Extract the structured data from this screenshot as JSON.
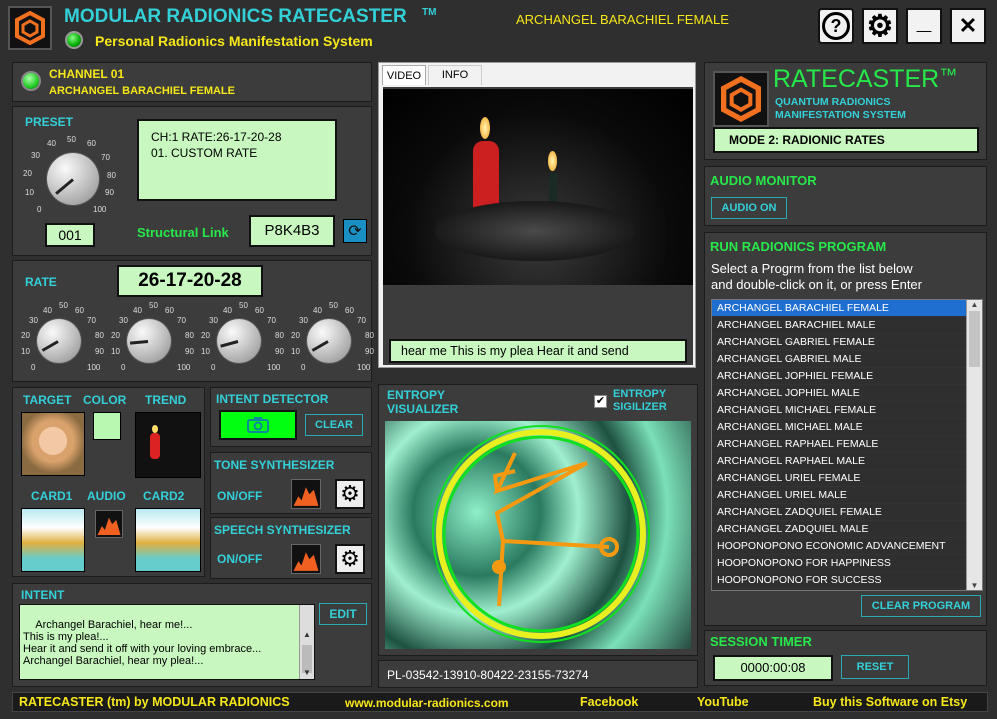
{
  "app": {
    "title": "MODULAR RADIONICS RATECASTER",
    "tm": "TM",
    "subtitle": "Personal Radionics Manifestation System",
    "current_program": "ARCHANGEL BARACHIEL FEMALE"
  },
  "window_buttons": {
    "help": "?",
    "settings": "⚙",
    "minimize": "_",
    "close": "✕"
  },
  "channel": {
    "label": "CHANNEL 01",
    "name": "ARCHANGEL BARACHIEL FEMALE"
  },
  "preset": {
    "label": "PRESET",
    "display_line1": "CH:1  RATE:26-17-20-28",
    "display_line2": "01. CUSTOM RATE",
    "value": "001",
    "structural_link_label": "Structural Link",
    "structural_link_value": "P8K4B3",
    "knob_ticks": [
      "0",
      "10",
      "20",
      "30",
      "40",
      "50",
      "60",
      "70",
      "80",
      "90",
      "100"
    ]
  },
  "rate": {
    "label": "RATE",
    "value": "26-17-20-28"
  },
  "target": {
    "target_label": "TARGET",
    "color_label": "COLOR",
    "trend_label": "TREND",
    "card1_label": "CARD1",
    "audio_label": "AUDIO",
    "card2_label": "CARD2",
    "color_hex": "#b8f8b0"
  },
  "intent_detector": {
    "label": "INTENT DETECTOR",
    "clear": "CLEAR"
  },
  "tone": {
    "label": "TONE SYNTHESIZER",
    "onoff": "ON/OFF"
  },
  "speech": {
    "label": "SPEECH SYNTHESIZER",
    "onoff": "ON/OFF"
  },
  "intent": {
    "label": "INTENT",
    "edit": "EDIT",
    "text": "Archangel Barachiel, hear me!...\nThis is my plea!...\nHear it and send it off with your loving embrace...\nArchangel Barachiel, hear my plea!..."
  },
  "video": {
    "tabs": [
      "VIDEO",
      "INFO"
    ],
    "caption": "hear me This is my plea Hear it and send"
  },
  "entropy": {
    "label_line1": "ENTROPY",
    "label_line2": "VISUALIZER",
    "sigilizer_line1": "ENTROPY",
    "sigilizer_line2": "SIGILIZER",
    "sigilizer_checked": true,
    "code": "PL-03542-13910-80422-23155-73274"
  },
  "ratecaster": {
    "title": "RATECASTER",
    "tm": "™",
    "sub1": "QUANTUM RADIONICS",
    "sub2": "MANIFESTATION SYSTEM",
    "mode": "MODE 2: RADIONIC RATES"
  },
  "audio_monitor": {
    "label": "AUDIO MONITOR",
    "button": "AUDIO ON"
  },
  "program": {
    "label": "RUN RADIONICS PROGRAM",
    "instructions_line1": "Select a Progrm from the list below",
    "instructions_line2": "and double-click on it, or press Enter",
    "clear": "CLEAR PROGRAM",
    "items": [
      "ARCHANGEL BARACHIEL FEMALE",
      "ARCHANGEL BARACHIEL MALE",
      "ARCHANGEL GABRIEL FEMALE",
      "ARCHANGEL GABRIEL MALE",
      "ARCHANGEL JOPHIEL FEMALE",
      "ARCHANGEL JOPHIEL MALE",
      "ARCHANGEL MICHAEL FEMALE",
      "ARCHANGEL MICHAEL MALE",
      "ARCHANGEL RAPHAEL FEMALE",
      "ARCHANGEL RAPHAEL MALE",
      "ARCHANGEL URIEL FEMALE",
      "ARCHANGEL URIEL MALE",
      "ARCHANGEL ZADQUIEL FEMALE",
      "ARCHANGEL ZADQUIEL MALE",
      "HOOPONOPONO ECONOMIC ADVANCEMENT",
      "HOOPONOPONO FOR HAPPINESS",
      "HOOPONOPONO FOR SUCCESS"
    ]
  },
  "session": {
    "label": "SESSION TIMER",
    "time": "0000:00:08",
    "reset": "RESET"
  },
  "footer": {
    "brand": "RATECASTER (tm) by MODULAR RADIONICS",
    "site": "www.modular-radionics.com",
    "facebook": "Facebook",
    "youtube": "YouTube",
    "etsy": "Buy this Software on Etsy"
  }
}
